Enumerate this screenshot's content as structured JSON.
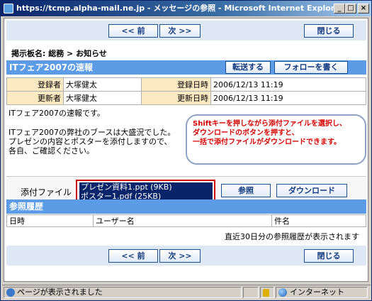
{
  "window": {
    "title": "https://tcmp.alpha-mail.ne.jp - メッセージの参照 - Microsoft Internet Explorer",
    "min_glyph": "_",
    "max_glyph": "□",
    "close_glyph": "×"
  },
  "nav": {
    "prev_label": "<< 前",
    "next_label": "次 >>",
    "close_label": "閉じる"
  },
  "breadcrumb": "掲示板名: 総務 > お知らせ",
  "message": {
    "title": "ITフェア2007の速報",
    "forward_label": "転送する",
    "follow_label": "フォローを書く",
    "registrant_label": "登録者",
    "registrant": "大塚健太",
    "registered_label": "登録日時",
    "registered": "2006/12/13 11:19",
    "updater_label": "更新者",
    "updater": "大塚健太",
    "updated_label": "更新日時",
    "updated": "2006/12/13 11:19",
    "body_line1": "ITフェア2007の速報です。",
    "body_line2": "ITフェア2007の弊社のブースは大盛況でした。",
    "body_line3": "プレゼンの内容とポスターを添付しますので、",
    "body_line4": "各自、ご確認ください。"
  },
  "callout": {
    "line1": "Shiftキーを押しながら添付ファイルを選択し、",
    "line2": "ダウンロードのボタンを押すと、",
    "line3": "一括で添付ファイルがダウンロードできます。"
  },
  "attachments": {
    "label": "添付ファイル",
    "files": [
      "プレゼン資料1.ppt (9KB)",
      "ポスター1.pdf (25KB)"
    ],
    "view_label": "参照",
    "download_label": "ダウンロード"
  },
  "history": {
    "title": "参照履歴",
    "col_datetime": "日時",
    "col_user": "ユーザー名",
    "col_subject": "件名",
    "note": "直近30日分の参照履歴が表示されます"
  },
  "status": {
    "text": "ページが表示されました",
    "zone": "インターネット"
  }
}
